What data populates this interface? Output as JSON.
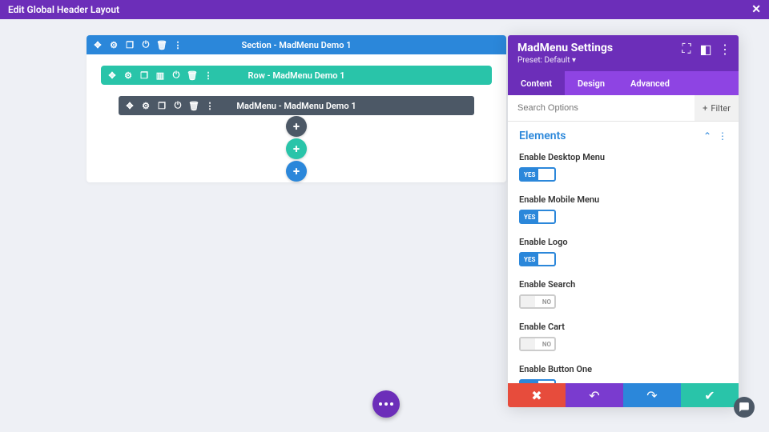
{
  "topbar": {
    "title": "Edit Global Header Layout"
  },
  "section": {
    "title": "Section - MadMenu Demo 1"
  },
  "row": {
    "title": "Row - MadMenu Demo 1"
  },
  "module": {
    "title": "MadMenu - MadMenu Demo 1"
  },
  "panel": {
    "title": "MadMenu Settings",
    "preset": "Preset: Default",
    "tabs": {
      "content": "Content",
      "design": "Design",
      "advanced": "Advanced"
    },
    "search_placeholder": "Search Options",
    "filter_label": "Filter",
    "group_title": "Elements",
    "options": [
      {
        "label": "Enable Desktop Menu",
        "on": true
      },
      {
        "label": "Enable Mobile Menu",
        "on": true
      },
      {
        "label": "Enable Logo",
        "on": true
      },
      {
        "label": "Enable Search",
        "on": false
      },
      {
        "label": "Enable Cart",
        "on": false
      },
      {
        "label": "Enable Button One",
        "on": true
      }
    ],
    "toggle_yes": "YES",
    "toggle_no": "NO"
  }
}
